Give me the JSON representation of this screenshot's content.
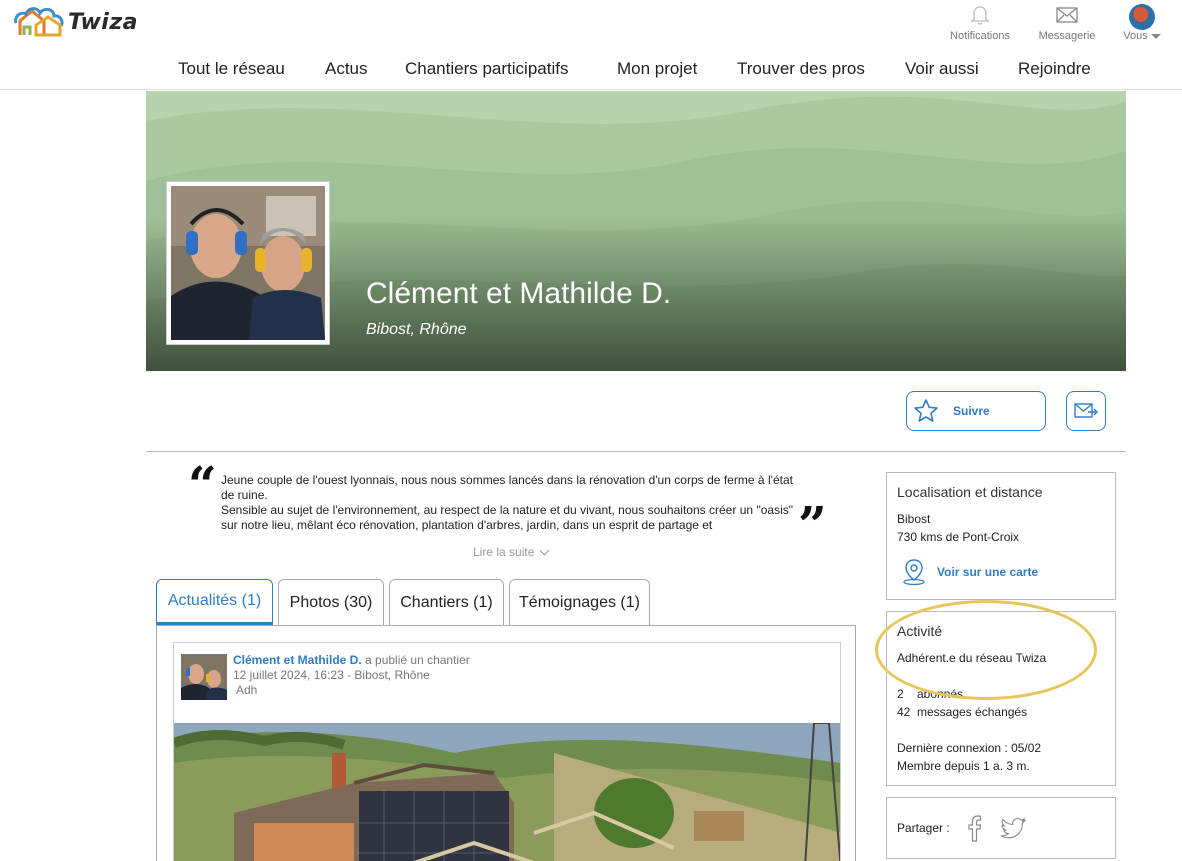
{
  "header": {
    "logo_text": "Twiza",
    "notifications_label": "Notifications",
    "messages_label": "Messagerie",
    "you_label": "Vous"
  },
  "nav": {
    "items": [
      "Tout le réseau",
      "Actus",
      "Chantiers participatifs",
      "Mon projet",
      "Trouver des pros",
      "Voir aussi",
      "Rejoindre"
    ]
  },
  "profile": {
    "name": "Clément et Mathilde D.",
    "location": "Bibost, Rhône",
    "follow_label": "Suivre"
  },
  "quote": {
    "paragraphs": [
      "Jeune couple de l'ouest lyonnais, nous nous sommes lancés dans la rénovation d'un corps de ferme à l'état de ruine.",
      "Sensible au sujet de l'environnement, au respect de la nature et du vivant, nous souhaitons créer un \"oasis\" sur notre lieu, mêlant éco rénovation, plantation d'arbres, jardin, dans un esprit de partage et"
    ],
    "read_more": "Lire la suite"
  },
  "tabs": [
    "Actualités (1)",
    "Photos (30)",
    "Chantiers (1)",
    "Témoignages (1)"
  ],
  "post": {
    "author": "Clément et Mathilde D.",
    "action": " a publié un chantier",
    "date": "12 juillet 2024, 16:23",
    "place": "  - Bibost, Rhône",
    "tag": "Adh"
  },
  "sidebar": {
    "location": {
      "title": "Localisation et distance",
      "city": "Bibost",
      "distance": "730 kms de Pont-Croix",
      "map_link": "Voir sur une carte"
    },
    "activity": {
      "title": "Activité",
      "member_line": "Adhérent.e du réseau Twiza",
      "subscribers": "2    abonnés",
      "messages": "42  messages échangés",
      "last_login": "Dernière connexion : 05/02",
      "member_since": "Membre depuis 1 a. 3 m."
    },
    "share": {
      "label": "Partager :"
    }
  },
  "colors": {
    "accent": "#2f7cc7",
    "banner_green": "#a7c69e",
    "highlight": "#e8c55a"
  }
}
